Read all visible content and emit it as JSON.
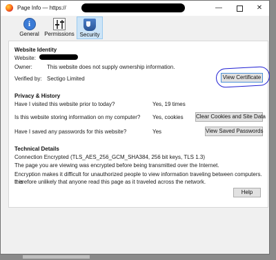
{
  "window": {
    "title_prefix": "Page Info — https://",
    "minimize_glyph": "—",
    "close_glyph": "✕"
  },
  "tabs": [
    {
      "label": "General",
      "icon": "info-icon"
    },
    {
      "label": "Permissions",
      "icon": "permissions-icon"
    },
    {
      "label": "Security",
      "icon": "shield-icon",
      "selected": true
    }
  ],
  "identity": {
    "heading": "Website Identity",
    "website_label": "Website:",
    "owner_label": "Owner:",
    "owner_value": "This website does not supply ownership information.",
    "verified_label": "Verified by:",
    "verified_value": "Sectigo Limited",
    "view_certificate": "View Certificate"
  },
  "privacy": {
    "heading": "Privacy & History",
    "q1": "Have I visited this website prior to today?",
    "a1": "Yes, 19 times",
    "q2": "Is this website storing information on my computer?",
    "a2": "Yes, cookies",
    "clear_button": "Clear Cookies and Site Data",
    "q3": "Have I saved any passwords for this website?",
    "a3": "Yes",
    "saved_button": "View Saved Passwords"
  },
  "technical": {
    "heading": "Technical Details",
    "connection": "Connection Encrypted (TLS_AES_256_GCM_SHA384, 256 bit keys, TLS 1.3)",
    "line2": "The page you are viewing was encrypted before being transmitted over the Internet.",
    "line3a": "Encryption makes it difficult for unauthorized people to view information traveling between computers. It is",
    "line3b": "therefore unlikely that anyone read this page as it traveled across the network."
  },
  "help_button": "Help",
  "colors": {
    "selected_tab": "#cce4f7",
    "annotation_circle": "#1a1ad2",
    "panel": "#ffffff",
    "chrome": "#f0f0f0"
  }
}
